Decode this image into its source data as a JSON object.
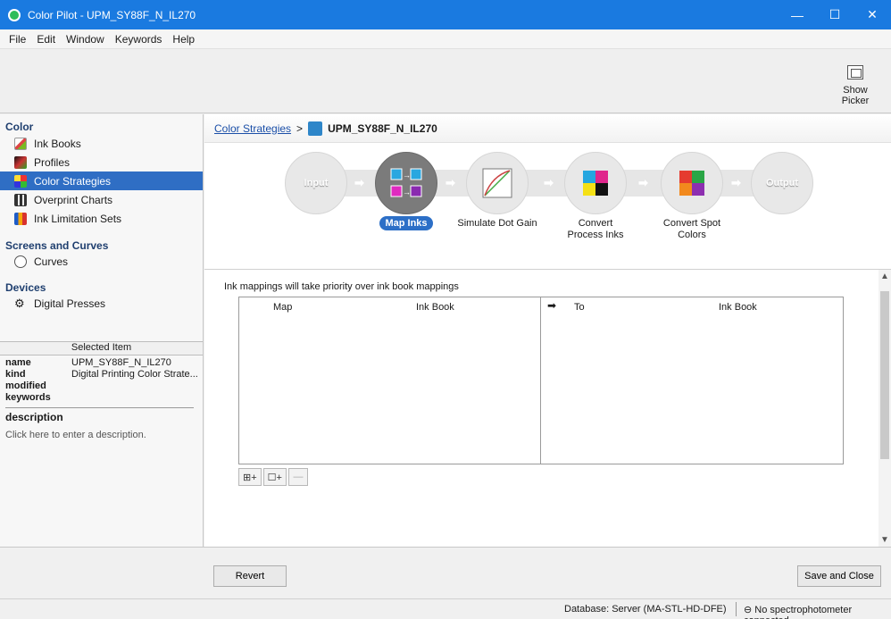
{
  "window": {
    "title": "Color Pilot - UPM_SY88F_N_IL270",
    "minimize": "—",
    "maximize": "☐",
    "close": "✕"
  },
  "menu": [
    "File",
    "Edit",
    "Window",
    "Keywords",
    "Help"
  ],
  "toolbar": {
    "show_picker": "Show Picker"
  },
  "sidebar": {
    "color_title": "Color",
    "color_items": [
      {
        "label": "Ink Books",
        "icon": "ink-book-icon"
      },
      {
        "label": "Profiles",
        "icon": "profile-icon"
      },
      {
        "label": "Color Strategies",
        "icon": "color-strategy-icon",
        "selected": true
      },
      {
        "label": "Overprint Charts",
        "icon": "overprint-chart-icon"
      },
      {
        "label": "Ink Limitation Sets",
        "icon": "ink-limitation-icon"
      }
    ],
    "screens_title": "Screens and Curves",
    "screens_items": [
      {
        "label": "Curves",
        "icon": "curves-icon"
      }
    ],
    "devices_title": "Devices",
    "devices_items": [
      {
        "label": "Digital Presses",
        "icon": "gears-icon"
      }
    ]
  },
  "selected_item": {
    "header": "Selected Item",
    "name_key": "name",
    "name_value": "UPM_SY88F_N_IL270",
    "kind_key": "kind",
    "kind_value": "Digital Printing Color Strate...",
    "modified_key": "modified",
    "keywords_key": "keywords",
    "description_title": "description",
    "description_hint": "Click here to enter a description."
  },
  "breadcrumb": {
    "parent": "Color Strategies",
    "separator": ">",
    "current": "UPM_SY88F_N_IL270"
  },
  "workflow": {
    "input": "Input",
    "output": "Output",
    "steps": [
      {
        "label": "Map Inks",
        "active": true
      },
      {
        "label": "Simulate Dot Gain"
      },
      {
        "label": "Convert Process Inks"
      },
      {
        "label": "Convert Spot Colors"
      }
    ]
  },
  "mapping": {
    "note": "Ink mappings will take priority over ink book mappings",
    "col_map": "Map",
    "col_inkbook_left": "Ink Book",
    "col_to": "To",
    "col_inkbook_right": "Ink Book",
    "add_set_button": "⊞+",
    "add_button": "☐+",
    "remove_button": "—"
  },
  "footer": {
    "revert": "Revert",
    "save_close": "Save and Close"
  },
  "status": {
    "database": "Database: Server (MA-STL-HD-DFE)",
    "spectro": "⊖ No spectrophotometer connected"
  },
  "colors": {
    "titlebar": "#1a7ae0",
    "selection": "#2f6ec4",
    "active_step": "#7b7b7b",
    "link": "#1b4fa8"
  }
}
